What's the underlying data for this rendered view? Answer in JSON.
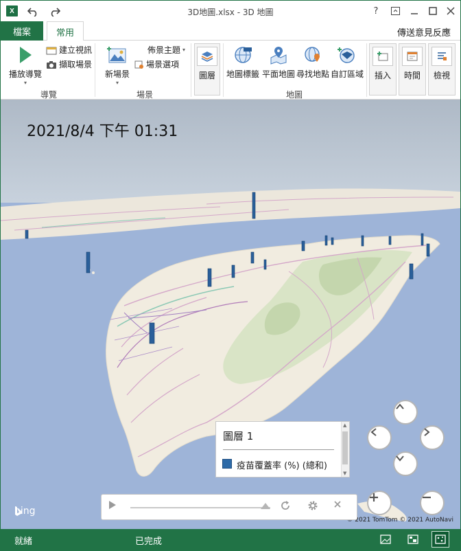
{
  "window": {
    "app_icon": "X",
    "title": "3D地圖.xlsx - 3D 地圖",
    "help_label": "?"
  },
  "tabs": {
    "file": "檔案",
    "home": "常用",
    "feedback": "傳送意見反應"
  },
  "ribbon": {
    "navigation": {
      "play_tour": "播放導覽",
      "create_video": "建立視訊",
      "capture_screen": "擷取場景",
      "group_label": "導覽"
    },
    "scene": {
      "new_scene": "新場景",
      "themes": "佈景主題",
      "scene_options": "場景選項",
      "group_label": "場景"
    },
    "layer": {
      "layer_pane": "圖層"
    },
    "map": {
      "map_labels": "地圖標籤",
      "flat_map": "平面地圖",
      "find_location": "尋找地點",
      "custom_regions": "自訂區域",
      "group_label": "地圖"
    },
    "insert": "插入",
    "time": "時間",
    "view": "檢視"
  },
  "map": {
    "timestamp": "2021/8/4 下午 01:31",
    "bing_label": "bing",
    "credits": "© 2021 TomTom  © 2021 AutoNavi",
    "colors": {
      "sea": "#9eb4d8",
      "land": "#f1ece0",
      "bar": "#2a5f9a"
    }
  },
  "legend": {
    "title": "圖層 1",
    "item": "疫苗覆蓋率 (%) (總和)",
    "swatch_color": "#2e6ba8"
  },
  "status": {
    "ready": "就緒",
    "done": "已完成"
  }
}
